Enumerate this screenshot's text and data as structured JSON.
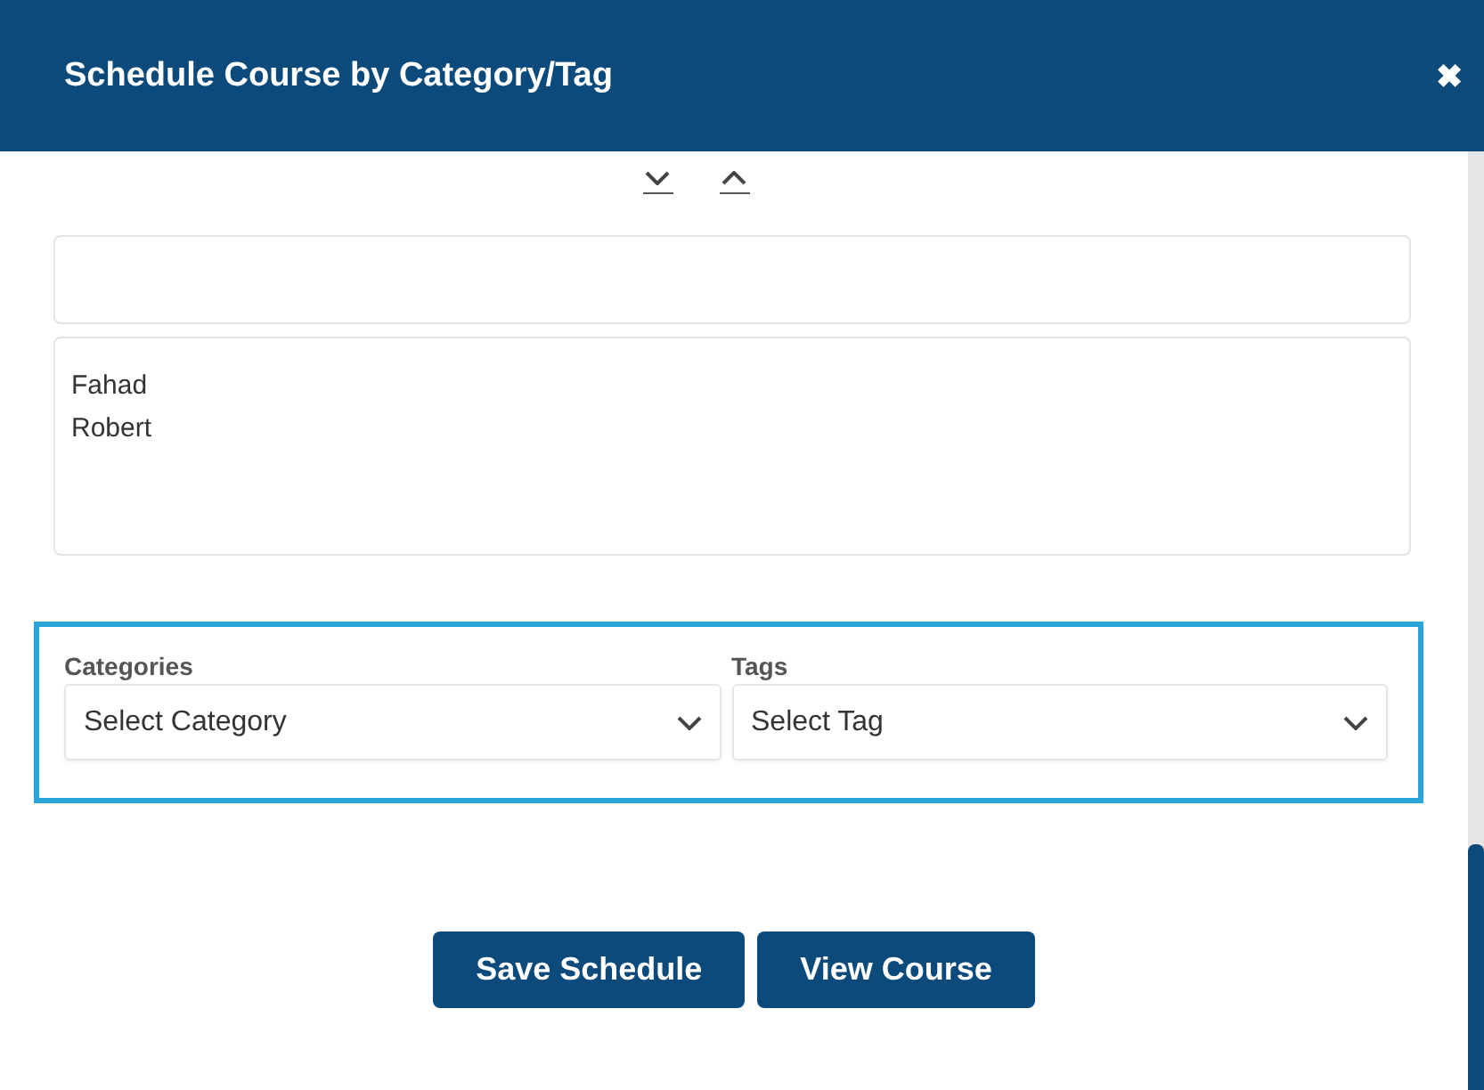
{
  "dialog": {
    "title": "Schedule Course by Category/Tag",
    "close": "✖"
  },
  "sort_controls": [
    {
      "kind": "down"
    },
    {
      "kind": "up"
    }
  ],
  "names": [
    "Fahad",
    "Robert"
  ],
  "filters": [
    {
      "label": "Categories",
      "placeholder": "Select Category"
    },
    {
      "label": "Tags",
      "placeholder": "Select Tag"
    }
  ],
  "buttons": [
    "Save Schedule",
    "View Course"
  ]
}
